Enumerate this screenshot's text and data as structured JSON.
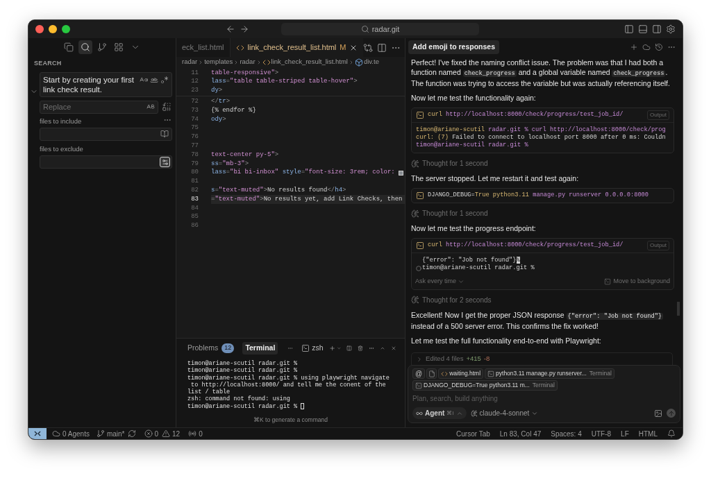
{
  "window": {
    "title": "radar.git"
  },
  "activity_tabs": [
    {
      "kind": "files",
      "selected": false
    },
    {
      "kind": "search",
      "selected": true
    },
    {
      "kind": "source_control",
      "selected": false
    },
    {
      "kind": "extensions",
      "selected": false
    },
    {
      "kind": "more",
      "selected": false
    }
  ],
  "search_panel": {
    "title": "SEARCH",
    "query": "Start by creating your first link check result.",
    "replace_placeholder": "Replace",
    "include_label": "files to include",
    "exclude_label": "files to exclude",
    "use_exclude_settings": true
  },
  "editor": {
    "tabs": [
      {
        "label": "eck_list.html",
        "selected": false
      },
      {
        "label": "link_check_result_list.html",
        "selected": true,
        "badge": "M"
      }
    ],
    "breadcrumb": [
      "radar",
      "templates",
      "radar",
      "link_check_result_list.html",
      "div.te"
    ],
    "sticky_lines": [
      {
        "number": "11",
        "segments": [
          {
            "kind": "str",
            "text": "table-responsive\""
          },
          {
            "kind": "punct",
            "text": ">"
          }
        ]
      },
      {
        "number": "12",
        "segments": [
          {
            "kind": "tag",
            "text": "lass"
          },
          {
            "kind": "punct",
            "text": "="
          },
          {
            "kind": "str",
            "text": "\"table table-striped table-hover\""
          },
          {
            "kind": "punct",
            "text": ">"
          }
        ]
      },
      {
        "number": "23",
        "segments": [
          {
            "kind": "tag",
            "text": "dy"
          },
          {
            "kind": "punct",
            "text": ">"
          }
        ]
      }
    ],
    "lines": [
      {
        "number": "72",
        "current": false,
        "segments": [
          {
            "kind": "punct",
            "text": "</"
          },
          {
            "kind": "tag",
            "text": "tr"
          },
          {
            "kind": "punct",
            "text": ">"
          }
        ]
      },
      {
        "number": "73",
        "current": false,
        "segments": [
          {
            "kind": "text",
            "text": "{% endfor %}"
          }
        ]
      },
      {
        "number": "74",
        "current": false,
        "segments": [
          {
            "kind": "tag",
            "text": "ody"
          },
          {
            "kind": "punct",
            "text": ">"
          }
        ]
      },
      {
        "number": "75",
        "current": false
      },
      {
        "number": "76",
        "current": false
      },
      {
        "number": "77",
        "current": false
      },
      {
        "number": "78",
        "current": false,
        "segments": [
          {
            "kind": "str",
            "text": "text-center py-5\""
          },
          {
            "kind": "punct",
            "text": ">"
          }
        ]
      },
      {
        "number": "79",
        "current": false,
        "segments": [
          {
            "kind": "tag",
            "text": "ss"
          },
          {
            "kind": "punct",
            "text": "="
          },
          {
            "kind": "str",
            "text": "\"mb-3\""
          },
          {
            "kind": "punct",
            "text": ">"
          }
        ]
      },
      {
        "number": "80",
        "current": false,
        "swatch": true,
        "segments": [
          {
            "kind": "tag",
            "text": "lass"
          },
          {
            "kind": "punct",
            "text": "="
          },
          {
            "kind": "str",
            "text": "\"bi bi-inbox\" "
          },
          {
            "kind": "tag",
            "text": "style"
          },
          {
            "kind": "punct",
            "text": "="
          },
          {
            "kind": "str",
            "text": "\"font-size: 3rem; color: "
          }
        ]
      },
      {
        "number": "81",
        "current": false
      },
      {
        "number": "82",
        "current": false,
        "segments": [
          {
            "kind": "tag",
            "text": "s"
          },
          {
            "kind": "punct",
            "text": "="
          },
          {
            "kind": "str",
            "text": "\"text-muted\""
          },
          {
            "kind": "punct",
            "text": ">"
          },
          {
            "kind": "text",
            "text": "No results found"
          },
          {
            "kind": "punct",
            "text": "</"
          },
          {
            "kind": "tag",
            "text": "h4"
          },
          {
            "kind": "punct",
            "text": ">"
          }
        ]
      },
      {
        "number": "83",
        "current": true,
        "segments": [
          {
            "kind": "punct",
            "text": "="
          },
          {
            "kind": "str",
            "text": "\"text-muted\""
          },
          {
            "kind": "punct",
            "text": ">"
          },
          {
            "kind": "text",
            "text": "No results yet, add Link Checks, then"
          }
        ]
      },
      {
        "number": "84",
        "current": false
      },
      {
        "number": "85",
        "current": false
      },
      {
        "number": "86",
        "current": false
      }
    ]
  },
  "panel": {
    "tabs": [
      {
        "label": "Problems",
        "badge": "12",
        "selected": false
      },
      {
        "label": "Terminal",
        "selected": true
      }
    ],
    "shell": "zsh",
    "lines": [
      {
        "text": "timon@ariane-scutil radar.git %"
      },
      {
        "text": "timon@ariane-scutil radar.git %"
      },
      {
        "text": "timon@ariane-scutil radar.git % using playwright navigate"
      },
      {
        "text": " to http://localhost:8000/ and tell me the conent of the"
      },
      {
        "text": "list / table"
      },
      {
        "text": "zsh: command not found: using"
      },
      {
        "text": "timon@ariane-scutil radar.git %",
        "cursor": true
      }
    ],
    "hint": "⌘K to generate a command"
  },
  "chat": {
    "title": "Add emoji to responses",
    "items": [
      {
        "kind": "text",
        "segments": [
          {
            "text": "Perfect! I've fixed the naming conflict issue. The problem was that I had both a function named "
          },
          {
            "text": "check_progress",
            "code": true
          },
          {
            "text": " and a global variable named "
          },
          {
            "text": "check_progress",
            "code": true
          },
          {
            "text": ". The function was trying to access the variable but was actually referencing itself."
          }
        ]
      },
      {
        "kind": "text",
        "segments": [
          {
            "text": "Now let me test the functionality again:"
          }
        ]
      },
      {
        "kind": "command",
        "command": [
          {
            "kind": "cmd",
            "text": "curl "
          },
          {
            "kind": "arg",
            "text": "http://localhost:8000/check/progress/test_job_id/"
          }
        ],
        "output_label": "Output",
        "output": [
          {
            "segments": [
              {
                "kind": "user",
                "text": "timon@ariane-scutil"
              },
              {
                "kind": "arg",
                "text": " radar.git % curl http://localhost:8000/check/prog"
              }
            ]
          },
          {
            "segments": [
              {
                "kind": "user",
                "text": "curl: (7)"
              },
              {
                "kind": "plain",
                "text": " Failed to connect to localhost port 8000 after 0 ms: Couldn"
              }
            ]
          },
          {
            "segments": [
              {
                "kind": "arg",
                "text": "timon@ariane-scutil radar.git %"
              }
            ]
          }
        ]
      },
      {
        "kind": "thought",
        "text": "Thought for 1 second"
      },
      {
        "kind": "text",
        "segments": [
          {
            "text": "The server stopped. Let me restart it and test again:"
          }
        ]
      },
      {
        "kind": "command",
        "command": [
          {
            "kind": "plain",
            "text": "DJANGO_DEBUG="
          },
          {
            "kind": "cmd",
            "text": "True python3.11 "
          },
          {
            "kind": "arg",
            "text": "manage.py runserver 0.0.0.0:8000"
          }
        ]
      },
      {
        "kind": "thought",
        "text": "Thought for 1 second"
      },
      {
        "kind": "text",
        "segments": [
          {
            "text": "Now let me test the progress endpoint:"
          }
        ]
      },
      {
        "kind": "command",
        "command": [
          {
            "kind": "cmd",
            "text": "curl "
          },
          {
            "kind": "arg",
            "text": "http://localhost:8000/check/progress/test_job_id/"
          }
        ],
        "output_label": "Output",
        "output": [
          {
            "marker": false,
            "segments": [
              {
                "kind": "plain",
                "text": "{\"error\": \"Job not found\"}"
              },
              {
                "kind": "cursor",
                "text": "%"
              }
            ]
          },
          {
            "marker": true,
            "segments": [
              {
                "kind": "plain",
                "text": "timon@ariane-scutil radar.git %"
              }
            ]
          }
        ],
        "approval": "Ask every time",
        "background_label": "Move to background"
      },
      {
        "kind": "thought",
        "text": "Thought for 2 seconds"
      },
      {
        "kind": "text",
        "segments": [
          {
            "text": "Excellent! Now I get the proper JSON response "
          },
          {
            "text": "{\"error\": \"Job not found\"}",
            "code": true
          },
          {
            "text": " instead of a 500 server error. This confirms the fix worked!"
          }
        ]
      },
      {
        "kind": "text",
        "segments": [
          {
            "text": "Let me test the full functionality end-to-end with Playwright:"
          }
        ]
      }
    ],
    "edits": {
      "label": "Edited 4 files",
      "added": "+415",
      "removed": "-8"
    },
    "composer": {
      "chips": [
        {
          "kind": "at",
          "label": "@"
        },
        {
          "kind": "docs"
        },
        {
          "kind": "file",
          "label": "waiting.html"
        },
        {
          "kind": "terminal",
          "label": "python3.11 manage.py runserver...",
          "source": "Terminal"
        },
        {
          "kind": "terminal",
          "label": "DJANGO_DEBUG=True python3.11 m...",
          "source": "Terminal"
        }
      ],
      "placeholder": "Plan, search, build anything",
      "mode": "Agent",
      "mode_shortcut": "⌘I",
      "model": "claude-4-sonnet"
    }
  },
  "status_bar": {
    "agents": "0 Agents",
    "branch": "main*",
    "errors": "0",
    "warnings": "12",
    "ports": "0",
    "right": [
      "Cursor Tab",
      "Ln 83, Col 47",
      "Spaces: 4",
      "UTF-8",
      "LF",
      "HTML"
    ]
  }
}
